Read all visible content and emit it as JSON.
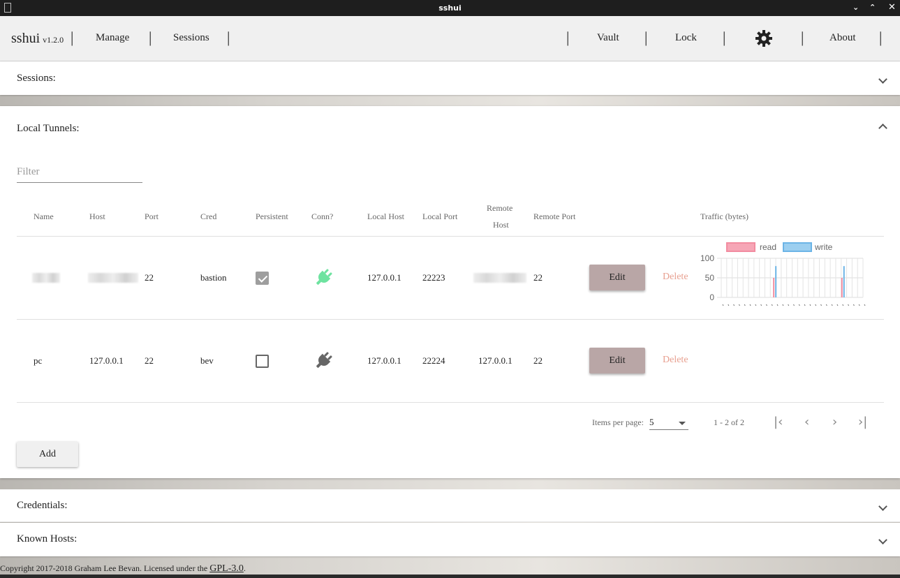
{
  "window": {
    "title": "sshui"
  },
  "nav": {
    "brand": "sshui",
    "version": "v1.2.0",
    "manage": "Manage",
    "sessions": "Sessions",
    "vault": "Vault",
    "lock": "Lock",
    "about": "About",
    "separator": "|"
  },
  "panels": {
    "sessions": "Sessions:",
    "local_tunnels": "Local Tunnels:",
    "credentials": "Credentials:",
    "known_hosts": "Known Hosts:"
  },
  "filter": {
    "placeholder": "Filter"
  },
  "table": {
    "headers": {
      "name": "Name",
      "host": "Host",
      "port": "Port",
      "cred": "Cred",
      "persistent": "Persistent",
      "conn": "Conn?",
      "local_host": "Local Host",
      "local_port": "Local Port",
      "remote_host_1": "Remote",
      "remote_host_2": "Host",
      "remote_port": "Remote Port",
      "traffic": "Traffic (bytes)"
    },
    "rows": [
      {
        "name": "",
        "host": "",
        "port": "22",
        "cred": "bastion",
        "persistent": true,
        "connected": true,
        "local_host": "127.0.0.1",
        "local_port": "22223",
        "remote_host": "",
        "remote_port": "22",
        "edit": "Edit",
        "delete": "Delete"
      },
      {
        "name": "pc",
        "host": "127.0.0.1",
        "port": "22",
        "cred": "bev",
        "persistent": false,
        "connected": false,
        "local_host": "127.0.0.1",
        "local_port": "22224",
        "remote_host": "127.0.0.1",
        "remote_port": "22",
        "edit": "Edit",
        "delete": "Delete"
      }
    ]
  },
  "chart_data": {
    "type": "bar",
    "ylim": [
      0,
      100
    ],
    "yticks": [
      "100",
      "50",
      "0"
    ],
    "series": [
      {
        "name": "read",
        "color": "#f28ca0",
        "spikes": [
          50,
          50
        ]
      },
      {
        "name": "write",
        "color": "#6cb4e6",
        "spikes": [
          80,
          80
        ]
      }
    ]
  },
  "pagination": {
    "items_per_page_label": "Items per page:",
    "items_per_page": "5",
    "range": "1 - 2 of 2"
  },
  "add_button": "Add",
  "footer": {
    "text": "Copyright 2017-2018 Graham Lee Bevan. Licensed under the ",
    "license": "GPL-3.0",
    "end": "."
  },
  "colors": {
    "connected": "#6ee3a0",
    "disconnected": "#666666",
    "edit_bg": "#b9a6a6",
    "delete": "#e8a090"
  }
}
